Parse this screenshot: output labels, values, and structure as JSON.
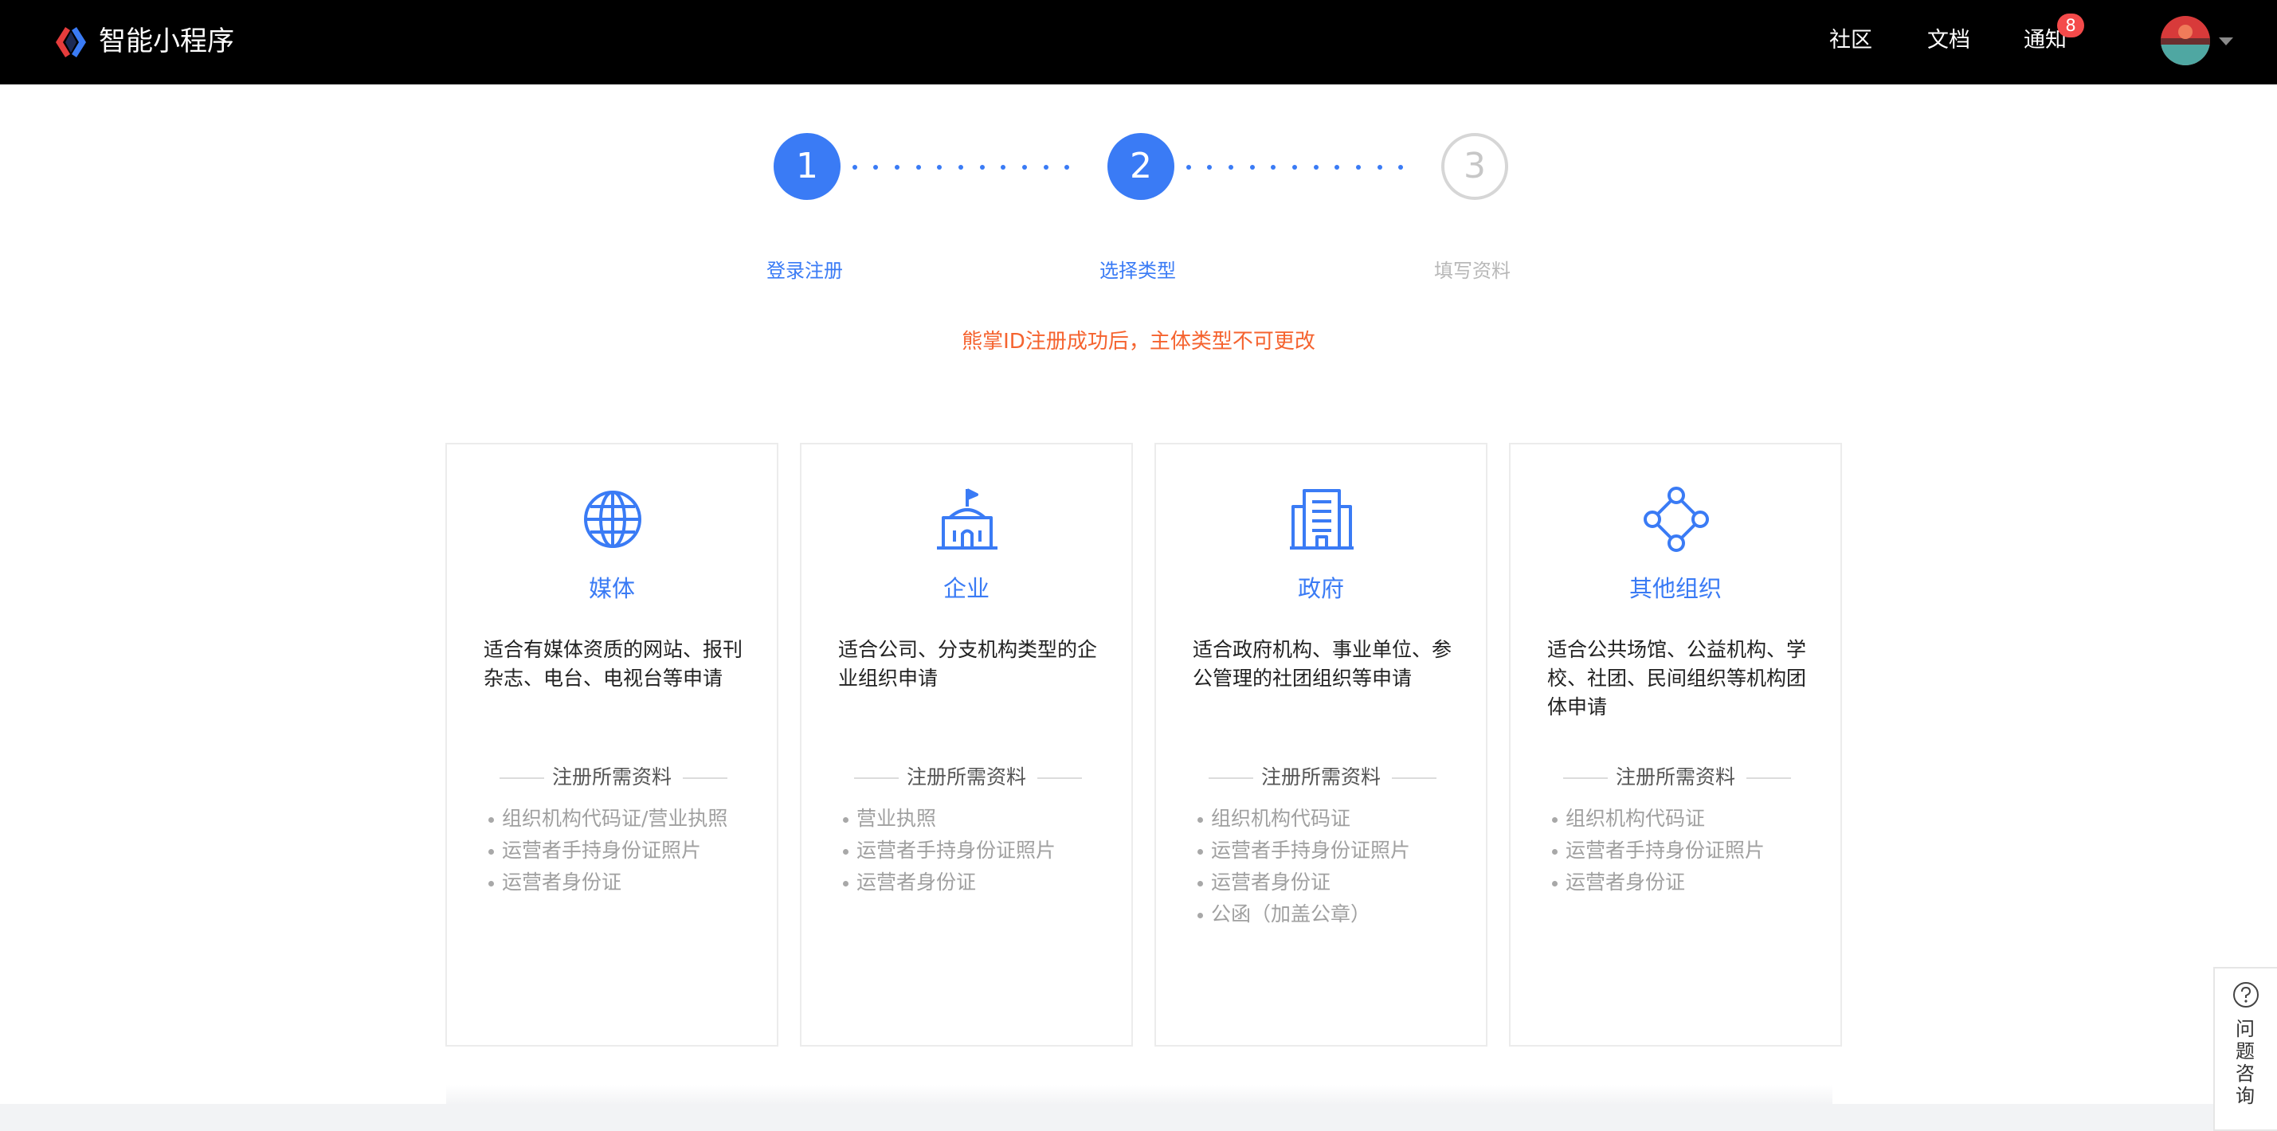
{
  "header": {
    "app_title": "智能小程序",
    "nav": [
      {
        "label": "社区"
      },
      {
        "label": "文档"
      },
      {
        "label": "通知"
      }
    ],
    "notification_count": "8"
  },
  "steps": [
    {
      "number": "1",
      "label": "登录注册",
      "state": "done"
    },
    {
      "number": "2",
      "label": "选择类型",
      "state": "current"
    },
    {
      "number": "3",
      "label": "填写资料",
      "state": "todo"
    }
  ],
  "notice": "熊掌ID注册成功后，主体类型不可更改",
  "cards": [
    {
      "icon": "globe-icon",
      "title": "媒体",
      "description": "适合有媒体资质的网站、报刊杂志、电台、电视台等申请",
      "requirements_header": "注册所需资料",
      "requirements": [
        "组织机构代码证/营业执照",
        "运营者手持身份证照片",
        "运营者身份证"
      ]
    },
    {
      "icon": "building-flag-icon",
      "title": "企业",
      "description": "适合公司、分支机构类型的企业组织申请",
      "requirements_header": "注册所需资料",
      "requirements": [
        "营业执照",
        "运营者手持身份证照片",
        "运营者身份证"
      ]
    },
    {
      "icon": "government-building-icon",
      "title": "政府",
      "description": "适合政府机构、事业单位、参公管理的社团组织等申请",
      "requirements_header": "注册所需资料",
      "requirements": [
        "组织机构代码证",
        "运营者手持身份证照片",
        "运营者身份证",
        "公函（加盖公章）"
      ]
    },
    {
      "icon": "network-nodes-icon",
      "title": "其他组织",
      "description": "适合公共场馆、公益机构、学校、社团、民间组织等机构团体申请",
      "requirements_header": "注册所需资料",
      "requirements": [
        "组织机构代码证",
        "运营者手持身份证照片",
        "运营者身份证"
      ]
    }
  ],
  "help": {
    "label": "问题咨询"
  },
  "colors": {
    "accent": "#3a7bf5",
    "warning": "#f5632f",
    "badge": "#f44a4a",
    "topbar": "#000000"
  }
}
